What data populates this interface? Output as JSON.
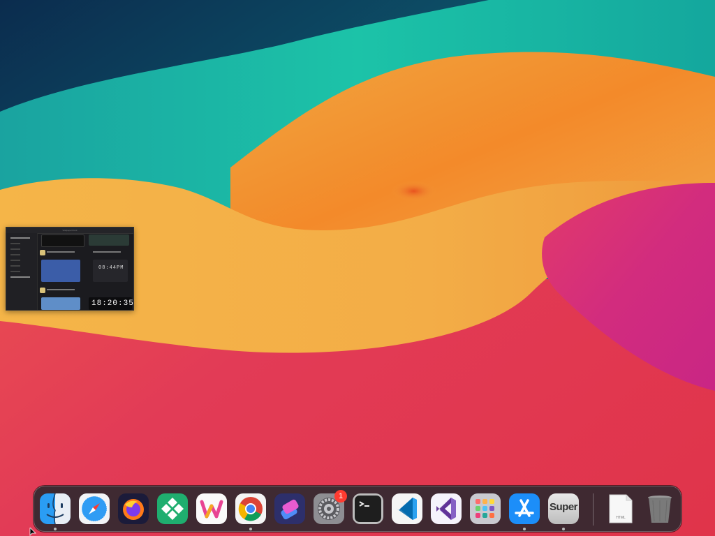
{
  "desktop": {
    "wallpaper": "sonoma-style gradient waves (teal, orange, magenta, red)"
  },
  "minimized_window": {
    "title_text": "WallpaperClock",
    "clock_text": "08:44PM",
    "big_clock_text": "18:20:35"
  },
  "dock": {
    "apps": [
      {
        "name": "Finder",
        "icon": "finder-icon",
        "running": true
      },
      {
        "name": "Safari",
        "icon": "safari-icon",
        "running": false
      },
      {
        "name": "Firefox",
        "icon": "firefox-icon",
        "running": false
      },
      {
        "name": "Dock app",
        "icon": "green-diamond-icon",
        "running": false
      },
      {
        "name": "Wave app",
        "icon": "w-app-icon",
        "running": false
      },
      {
        "name": "Chrome",
        "icon": "chrome-icon",
        "running": true
      },
      {
        "name": "Shortcuts",
        "icon": "shortcuts-icon",
        "running": false
      },
      {
        "name": "System Settings",
        "icon": "gear-icon",
        "running": false,
        "badge": "1"
      },
      {
        "name": "Terminal",
        "icon": "terminal-icon",
        "running": false
      },
      {
        "name": "Visual Studio Code",
        "icon": "vscode-icon",
        "running": false
      },
      {
        "name": "Visual Studio",
        "icon": "visual-studio-icon",
        "running": false
      },
      {
        "name": "Launchpad",
        "icon": "launchpad-icon",
        "running": false
      },
      {
        "name": "App Store",
        "icon": "app-store-icon",
        "running": true
      },
      {
        "name": "Super",
        "icon": "super-icon",
        "running": true,
        "label": "Super"
      }
    ],
    "stack": [
      {
        "name": "HTML document",
        "icon": "html-file-icon",
        "label": "HTML"
      },
      {
        "name": "Trash",
        "icon": "trash-icon"
      }
    ]
  },
  "colors": {
    "badge": "#ff3b30",
    "dock_bg": "#28282e"
  }
}
